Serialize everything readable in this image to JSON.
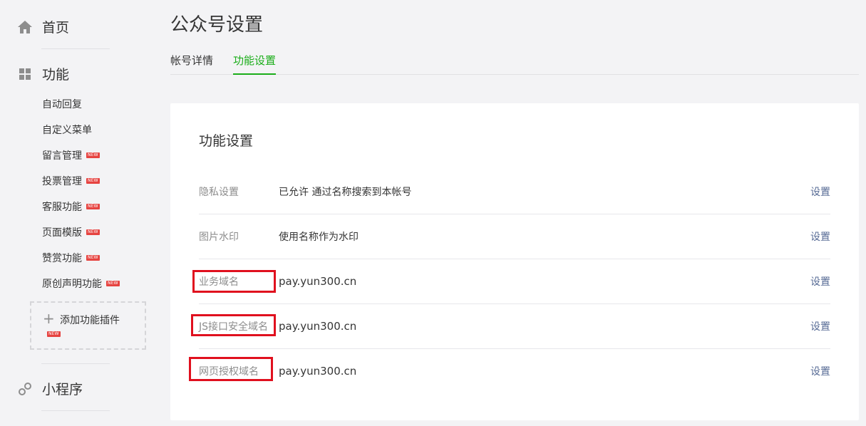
{
  "sidebar": {
    "home_label": "首页",
    "functions_label": "功能",
    "items": [
      {
        "label": "自动回复",
        "new": false
      },
      {
        "label": "自定义菜单",
        "new": false
      },
      {
        "label": "留言管理",
        "new": true
      },
      {
        "label": "投票管理",
        "new": true
      },
      {
        "label": "客服功能",
        "new": true
      },
      {
        "label": "页面模版",
        "new": true
      },
      {
        "label": "赞赏功能",
        "new": true
      },
      {
        "label": "原创声明功能",
        "new": true
      }
    ],
    "new_badge": "NEW",
    "add_plugin_label": "添加功能插件",
    "mini_program_label": "小程序",
    "icons": {
      "home": "home-icon",
      "functions": "grid-icon",
      "mini_program": "link-icon",
      "add": "plus-icon"
    }
  },
  "header": {
    "title": "公众号设置",
    "tabs": [
      {
        "label": "帐号详情",
        "active": false
      },
      {
        "label": "功能设置",
        "active": true
      }
    ]
  },
  "card": {
    "title": "功能设置",
    "rows": [
      {
        "key": "隐私设置",
        "value": "已允许 通过名称搜索到本帐号",
        "action": "设置",
        "highlighted": false
      },
      {
        "key": "图片水印",
        "value": "使用名称作为水印",
        "action": "设置",
        "highlighted": false
      },
      {
        "key": "业务域名",
        "value": "pay.yun300.cn",
        "action": "设置",
        "highlighted": true
      },
      {
        "key": "JS接口安全域名",
        "value": "pay.yun300.cn",
        "action": "设置",
        "highlighted": true
      },
      {
        "key": "网页授权域名",
        "value": "pay.yun300.cn",
        "action": "设置",
        "highlighted": true
      }
    ]
  },
  "colors": {
    "accent": "#1aad19",
    "link": "#576b95",
    "badge": "#e64340",
    "highlight_box": "#e0101e"
  }
}
